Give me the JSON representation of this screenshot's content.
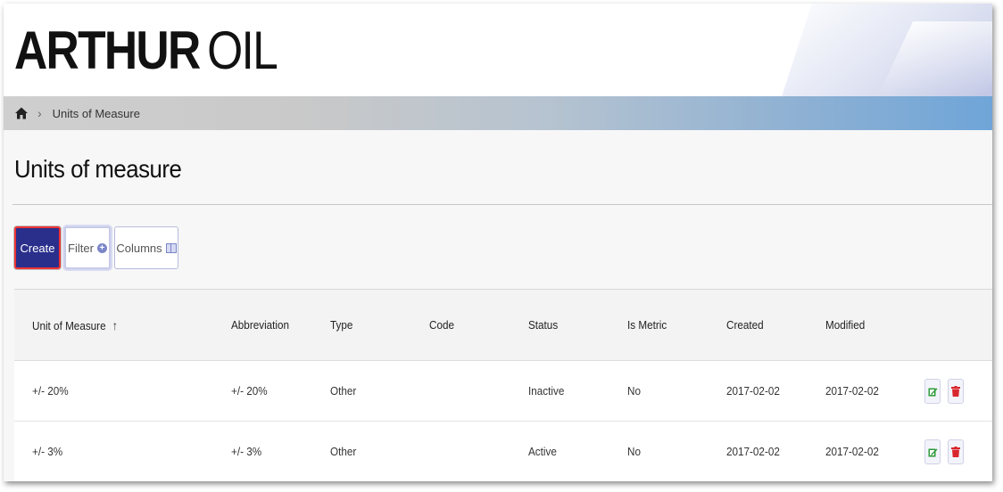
{
  "brand": {
    "name_bold": "ARTHUR",
    "name_light": "OIL"
  },
  "breadcrumb": {
    "current": "Units of Measure"
  },
  "page": {
    "title": "Units of measure"
  },
  "toolbar": {
    "create_label": "Create",
    "filter_label": "Filter",
    "columns_label": "Columns"
  },
  "table": {
    "headers": [
      "Unit of Measure",
      "Abbreviation",
      "Type",
      "Code",
      "Status",
      "Is Metric",
      "Created",
      "Modified"
    ],
    "sort_column": "Unit of Measure",
    "sort_direction": "ascending",
    "rows": [
      {
        "unit": "+/- 20%",
        "abbreviation": "+/- 20%",
        "type": "Other",
        "code": "",
        "status": "Inactive",
        "is_metric": "No",
        "created": "2017-02-02",
        "modified": "2017-02-02"
      },
      {
        "unit": "+/- 3%",
        "abbreviation": "+/- 3%",
        "type": "Other",
        "code": "",
        "status": "Active",
        "is_metric": "No",
        "created": "2017-02-02",
        "modified": "2017-02-02"
      }
    ]
  },
  "colors": {
    "primary": "#2a2f8c",
    "edit": "#2e9a3a",
    "delete": "#d9262e"
  }
}
